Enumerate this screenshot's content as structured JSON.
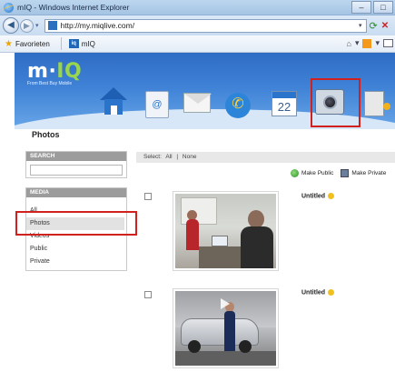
{
  "browser": {
    "window_title": "mIQ - Windows Internet Explorer",
    "url": "http://my.miqlive.com/",
    "favorites_label": "Favorieten",
    "tab_title": "mIQ"
  },
  "site": {
    "logo_text_m": "m",
    "logo_text_iq": "IQ",
    "logo_dot": "·",
    "logo_tagline": "From Best Buy Mobile",
    "nav_icons": [
      "home-icon",
      "contacts-icon",
      "mail-icon",
      "phone-icon",
      "calendar-icon",
      "camera-icon",
      "video-icon"
    ],
    "calendar_day": "22",
    "contacts_glyph": "@",
    "highlight_color": "#d0211f",
    "banner_color": "#3f82d6"
  },
  "page": {
    "title": "Photos"
  },
  "sidebar": {
    "search_header": "SEARCH",
    "search_value": "",
    "media_header": "MEDIA",
    "media_items": [
      "All",
      "Photos",
      "Videos",
      "Public",
      "Private"
    ],
    "active_item": "Photos"
  },
  "toolbar": {
    "select_label": "Select:",
    "select_all": "All",
    "separator": "|",
    "select_none": "None",
    "make_public": "Make Public",
    "make_private": "Make Private"
  },
  "photos": [
    {
      "title": "Untitled"
    },
    {
      "title": "Untitled"
    }
  ]
}
